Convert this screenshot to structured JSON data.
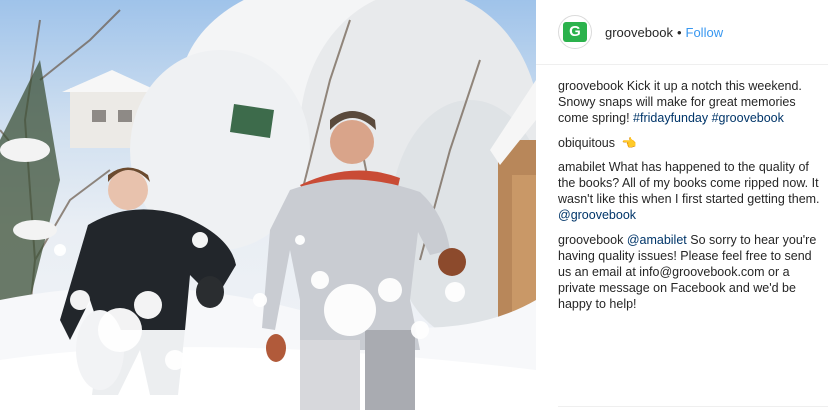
{
  "header": {
    "avatar_letter": "G",
    "username": "groovebook",
    "separator": "•",
    "follow_label": "Follow"
  },
  "caption": {
    "username": "groovebook",
    "text": "Kick it up a notch this weekend. Snowy snaps will make for great memories come spring!",
    "tags": [
      "#fridayfunday",
      "#groovebook"
    ]
  },
  "comments": [
    {
      "username": "obiquitous",
      "emoji": "👈"
    },
    {
      "username": "amabilet",
      "text": "What has happened to the quality of the books? All of my books come ripped now. It wasn't like this when I first started getting them.",
      "mention": "@groovebook"
    },
    {
      "username": "groovebook",
      "mention": "@amabilet",
      "text": "So sorry to hear you're having quality issues! Please feel free to send us an email at info@groovebook.com or a private message on Facebook and we'd be happy to help!"
    }
  ],
  "colors": {
    "brand_green": "#2bb24c",
    "follow_blue": "#3897f0",
    "link_navy": "#003569"
  }
}
